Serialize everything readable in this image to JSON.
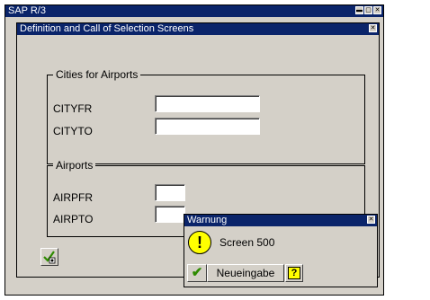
{
  "app": {
    "window_title": "SAP R/3",
    "window_buttons": [
      "▬",
      "▢",
      "✕"
    ]
  },
  "dialog": {
    "title": "Definition and Call of Selection Screens",
    "close_glyph": "✕",
    "groups": {
      "cities": {
        "title": "Cities for Airports",
        "fields": [
          {
            "label": "CITYFR",
            "value": ""
          },
          {
            "label": "CITYTO",
            "value": ""
          }
        ]
      },
      "airports": {
        "title": "Airports",
        "fields": [
          {
            "label": "AIRPFR",
            "value": ""
          },
          {
            "label": "AIRPTO",
            "value": ""
          }
        ]
      }
    },
    "execute_icon": "execute-icon"
  },
  "warning": {
    "title": "Warnung",
    "close_glyph": "✕",
    "message": "Screen 500",
    "icon": "!",
    "ok_icon": "✔",
    "re_entry_label": "Neueingabe",
    "help_icon": "?"
  },
  "colors": {
    "title_bar": "#0a246a",
    "window_bg": "#d4d0c8",
    "warning_yellow": "#ffff00",
    "check_green": "#2e8b00"
  }
}
